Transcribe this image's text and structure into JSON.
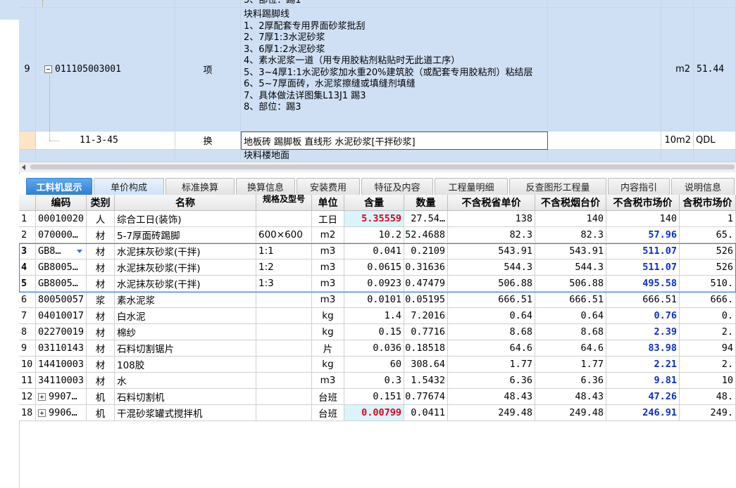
{
  "upper": {
    "row_top_partial": {
      "desc": "5、部位：踢1"
    },
    "row9": {
      "num": "9",
      "code": "011105003001",
      "type": "项",
      "desc": "块料踢脚线\n1、2厚配套专用界面砂浆批刮\n2、7厚1:3水泥砂浆\n3、6厚1:2水泥砂浆\n4、素水泥浆一道（用专用胶粘剂粘贴时无此道工序）\n5、3~4厚1:1水泥砂浆加水重20%建筑胶（或配套专用胶粘剂）粘结层\n6、5~7厚面砖，水泥浆擦缝或填缝剂填缝\n7、具体做法详图集L13J1 踢3\n8、部位：踢3",
      "unit": "m2",
      "qty": "51.44"
    },
    "row_sub": {
      "code": "11-3-45",
      "type": "换",
      "desc": "地板砖 踢脚板 直线形 水泥砂浆[干拌砂浆]",
      "unit": "10m2",
      "qty": "QDL"
    },
    "row_next_partial": {
      "desc": "块料楼地面"
    }
  },
  "tabs": [
    {
      "label": "工料机显示"
    },
    {
      "label": "单价构成"
    },
    {
      "label": "标准换算"
    },
    {
      "label": "换算信息"
    },
    {
      "label": "安装费用"
    },
    {
      "label": "特征及内容"
    },
    {
      "label": "工程量明细"
    },
    {
      "label": "反查图形工程量"
    },
    {
      "label": "内容指引"
    },
    {
      "label": "说明信息"
    }
  ],
  "lower": {
    "headers": [
      "编码",
      "类别",
      "名称",
      "规格及型号",
      "单位",
      "含量",
      "数量",
      "不含税省单价",
      "不含税烟台价",
      "不含税市场价",
      "含税市场价"
    ],
    "rows": [
      {
        "n": "1",
        "code": "00010020",
        "cat": "人",
        "name": "综合工日(装饰)",
        "spec": "",
        "unit": "工日",
        "content": "5.35559",
        "qty": "27.54…",
        "p1": "138",
        "p2": "140",
        "p3": "140",
        "p4": "1"
      },
      {
        "n": "2",
        "code": "070000…",
        "cat": "材",
        "name": "5-7厚面砖踢脚",
        "spec": "600×600",
        "unit": "m2",
        "content": "10.2",
        "qty": "52.4688",
        "p1": "82.3",
        "p2": "82.3",
        "p3": "57.96",
        "p4": "65."
      },
      {
        "n": "3",
        "code": "GB8…",
        "cat": "材",
        "name": "水泥抹灰砂浆(干拌)",
        "spec": "1:1",
        "unit": "m3",
        "content": "0.041",
        "qty": "0.2109",
        "p1": "543.91",
        "p2": "543.91",
        "p3": "511.07",
        "p4": "526"
      },
      {
        "n": "4",
        "code": "GB8005…",
        "cat": "材",
        "name": "水泥抹灰砂浆(干拌)",
        "spec": "1:2",
        "unit": "m3",
        "content": "0.0615",
        "qty": "0.31636",
        "p1": "544.3",
        "p2": "544.3",
        "p3": "511.07",
        "p4": "526"
      },
      {
        "n": "5",
        "code": "GB8005…",
        "cat": "材",
        "name": "水泥抹灰砂浆(干拌)",
        "spec": "1:3",
        "unit": "m3",
        "content": "0.0923",
        "qty": "0.47479",
        "p1": "506.88",
        "p2": "506.88",
        "p3": "495.58",
        "p4": "510."
      },
      {
        "n": "6",
        "code": "80050057",
        "cat": "浆",
        "name": "素水泥浆",
        "spec": "",
        "unit": "m3",
        "content": "0.0101",
        "qty": "0.05195",
        "p1": "666.51",
        "p2": "666.51",
        "p3": "666.51",
        "p4": "666."
      },
      {
        "n": "7",
        "code": "04010017",
        "cat": "材",
        "name": "白水泥",
        "spec": "",
        "unit": "kg",
        "content": "1.4",
        "qty": "7.2016",
        "p1": "0.64",
        "p2": "0.64",
        "p3": "0.76",
        "p4": "0."
      },
      {
        "n": "8",
        "code": "02270019",
        "cat": "材",
        "name": "棉纱",
        "spec": "",
        "unit": "kg",
        "content": "0.15",
        "qty": "0.7716",
        "p1": "8.68",
        "p2": "8.68",
        "p3": "2.39",
        "p4": "2."
      },
      {
        "n": "9",
        "code": "03110143",
        "cat": "材",
        "name": "石料切割锯片",
        "spec": "",
        "unit": "片",
        "content": "0.036",
        "qty": "0.18518",
        "p1": "64.6",
        "p2": "64.6",
        "p3": "83.98",
        "p4": "94"
      },
      {
        "n": "10",
        "code": "14410003",
        "cat": "材",
        "name": "108胶",
        "spec": "",
        "unit": "kg",
        "content": "60",
        "qty": "308.64",
        "p1": "1.77",
        "p2": "1.77",
        "p3": "2.21",
        "p4": "2."
      },
      {
        "n": "11",
        "code": "34110003",
        "cat": "材",
        "name": "水",
        "spec": "",
        "unit": "m3",
        "content": "0.3",
        "qty": "1.5432",
        "p1": "6.36",
        "p2": "6.36",
        "p3": "9.81",
        "p4": "10"
      },
      {
        "n": "12",
        "code": "9907…",
        "cat": "机",
        "name": "石料切割机",
        "spec": "",
        "unit": "台班",
        "content": "0.151",
        "qty": "0.77674",
        "p1": "48.43",
        "p2": "48.43",
        "p3": "47.26",
        "p4": "48."
      },
      {
        "n": "18",
        "code": "9906…",
        "cat": "机",
        "name": "干混砂浆罐式搅拌机",
        "spec": "",
        "unit": "台班",
        "content": "0.00799",
        "qty": "0.0411",
        "p1": "249.48",
        "p2": "249.48",
        "p3": "246.91",
        "p4": "249."
      }
    ]
  }
}
